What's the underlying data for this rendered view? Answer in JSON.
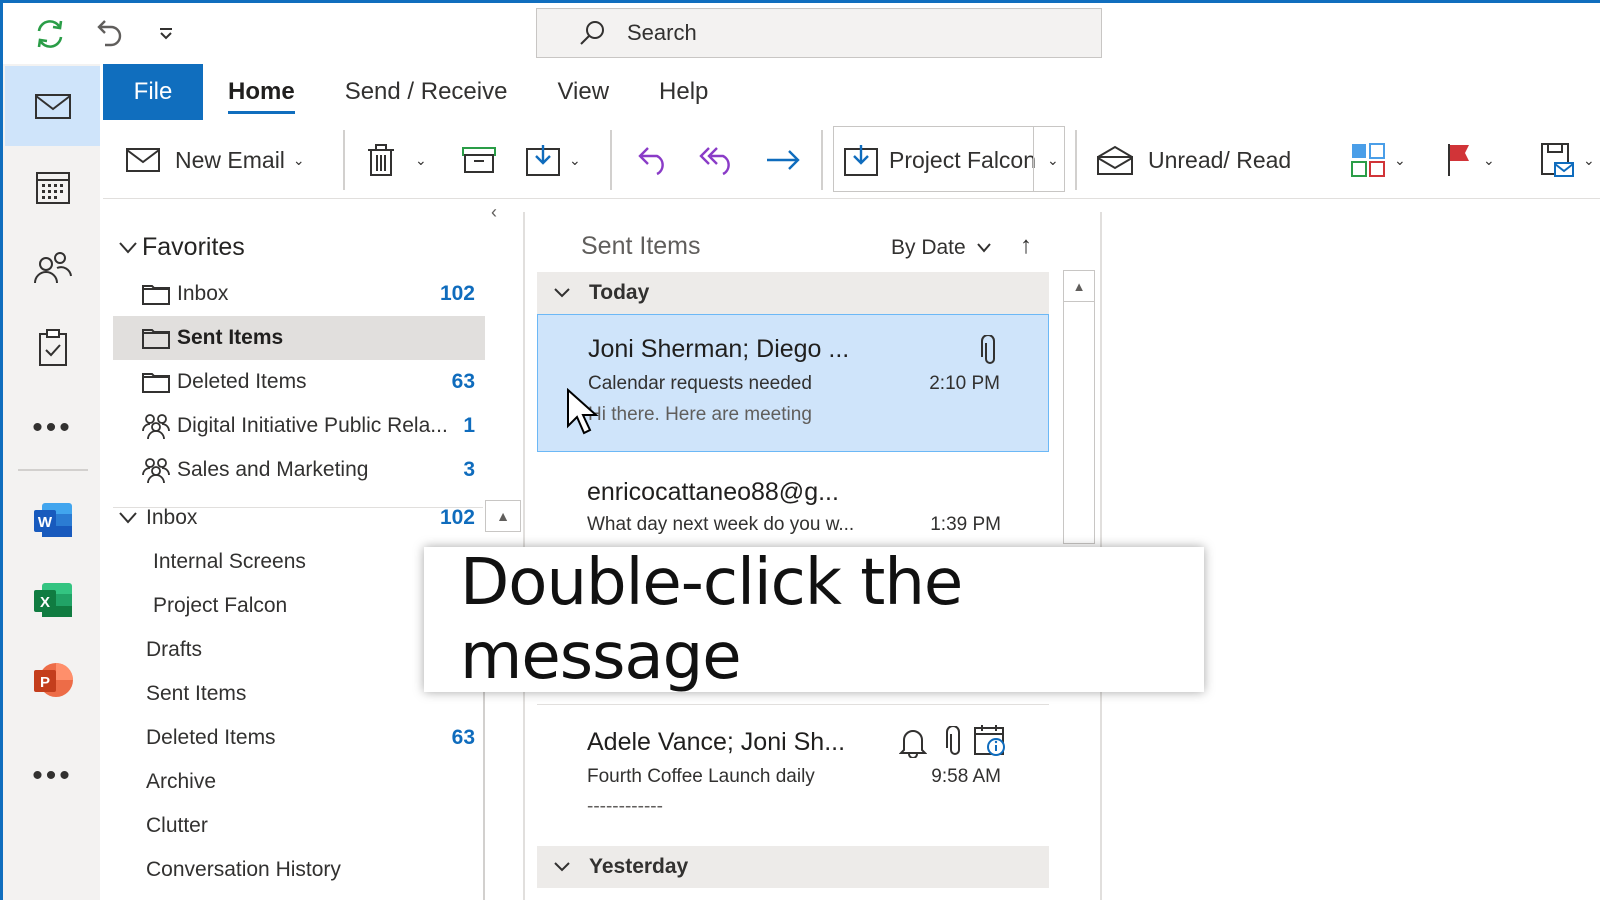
{
  "search": {
    "placeholder": "Search"
  },
  "ribbon_tabs": [
    "File",
    "Home",
    "Send / Receive",
    "View",
    "Help"
  ],
  "ribbon": {
    "new_email": "New Email",
    "move_to": "Project Falcon",
    "unread_read": "Unread/ Read"
  },
  "folder_pane": {
    "favorites_header": "Favorites",
    "favorites": [
      {
        "label": "Inbox",
        "count": "102"
      },
      {
        "label": "Sent Items",
        "count": ""
      },
      {
        "label": "Deleted Items",
        "count": "63"
      },
      {
        "label": "Digital Initiative Public Rela...",
        "count": "1"
      },
      {
        "label": "Sales and Marketing",
        "count": "3"
      }
    ],
    "inbox_header": {
      "label": "Inbox",
      "count": "102"
    },
    "folders": [
      {
        "label": "Internal Screens",
        "count": ""
      },
      {
        "label": "Project Falcon",
        "count": ""
      },
      {
        "label": "Drafts",
        "count": ""
      },
      {
        "label": "Sent Items",
        "count": ""
      },
      {
        "label": "Deleted Items",
        "count": "63"
      },
      {
        "label": "Archive",
        "count": ""
      },
      {
        "label": "Clutter",
        "count": ""
      },
      {
        "label": "Conversation History",
        "count": ""
      }
    ]
  },
  "message_list": {
    "title": "Sent Items",
    "sort": "By Date",
    "groups": {
      "today": "Today",
      "yesterday": "Yesterday"
    },
    "messages": [
      {
        "sender": "Joni Sherman; Diego ...",
        "subject": "Calendar requests needed",
        "preview": "Hi there. Here are meeting",
        "time": "2:10 PM"
      },
      {
        "sender": "enricocattaneo88@g...",
        "subject": "What day next week do you w...",
        "preview": "",
        "time": "1:39 PM"
      },
      {
        "sender": "Adele Vance; Joni Sh...",
        "subject": "Fourth Coffee Launch daily",
        "preview": "------------",
        "time": "9:58 AM"
      }
    ]
  },
  "callout": {
    "text": "Double-click the message"
  },
  "colors": {
    "accent": "#106ebe",
    "selected": "#cfe4fa",
    "count": "#0f6cbd"
  }
}
